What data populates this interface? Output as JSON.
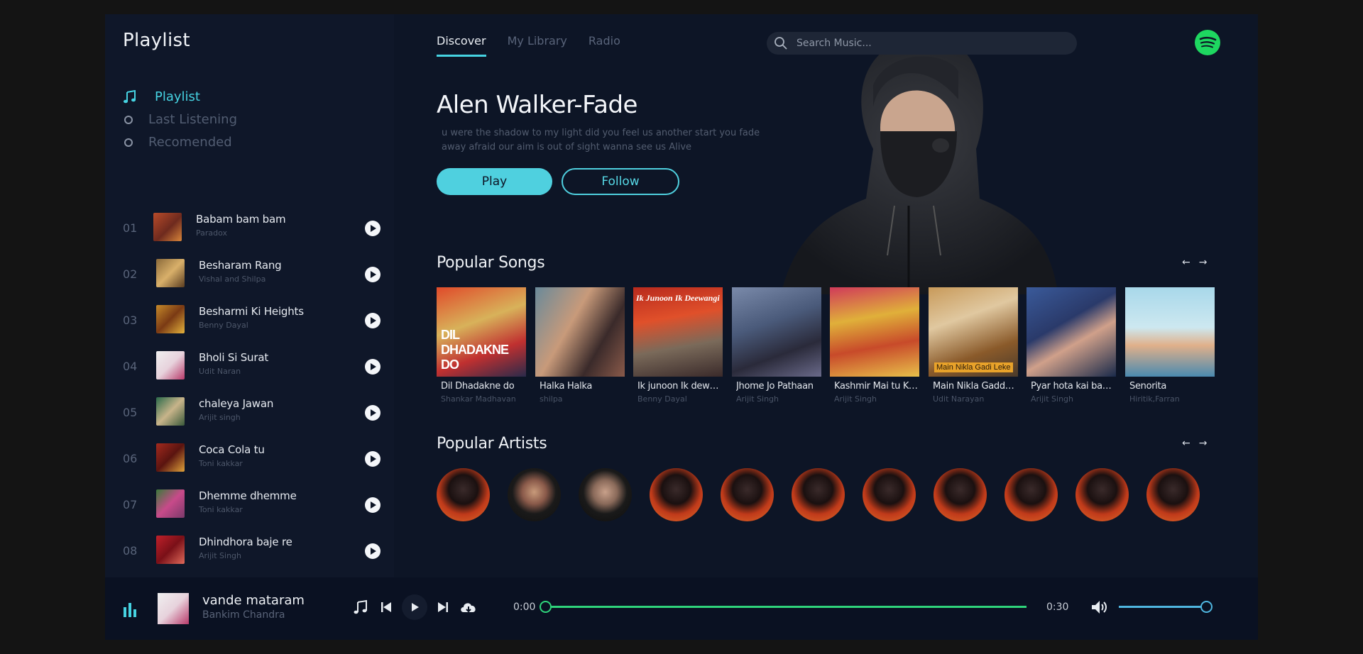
{
  "sidebar": {
    "title": "Playlist",
    "nav": [
      {
        "label": "Playlist",
        "icon": "music-note-icon",
        "active": true
      },
      {
        "label": "Last Listening",
        "icon": "circle-icon",
        "active": false
      },
      {
        "label": "Recomended",
        "icon": "circle-icon",
        "active": false
      }
    ],
    "tracks": [
      {
        "num": "01",
        "title": "Babam bam bam",
        "artist": "Paradox"
      },
      {
        "num": "02",
        "title": "Besharam Rang",
        "artist": "Vishal and Shilpa"
      },
      {
        "num": "03",
        "title": "Besharmi Ki Heights",
        "artist": "Benny Dayal"
      },
      {
        "num": "04",
        "title": "Bholi Si Surat",
        "artist": "Udit Naran"
      },
      {
        "num": "05",
        "title": "chaleya Jawan",
        "artist": "Arijit singh"
      },
      {
        "num": "06",
        "title": "Coca Cola tu",
        "artist": "Toni kakkar"
      },
      {
        "num": "07",
        "title": "Dhemme dhemme",
        "artist": "Toni kakkar"
      },
      {
        "num": "08",
        "title": "Dhindhora baje re",
        "artist": "Arijit Singh"
      }
    ]
  },
  "header": {
    "tabs": [
      {
        "label": "Discover",
        "active": true
      },
      {
        "label": "My Library",
        "active": false
      },
      {
        "label": "Radio",
        "active": false
      }
    ],
    "search_placeholder": "Search Music..."
  },
  "hero": {
    "title": "Alen Walker-Fade",
    "lyrics": "u were the shadow to my light did you feel us another start you fade away afraid our aim is out of sight wanna see us Alive",
    "play_label": "Play",
    "follow_label": "Follow"
  },
  "popular_songs": {
    "title": "Popular Songs",
    "prev": "←",
    "next": "→",
    "items": [
      {
        "title": "Dil Dhadakne do",
        "artist": "Shankar Madhavan",
        "cover_text": "DIL DHADAKNE DO"
      },
      {
        "title": "Halka Halka",
        "artist": "shilpa"
      },
      {
        "title": "Ik junoon Ik dewan...",
        "artist": "Benny Dayal",
        "cover_text": "Ik Junoon Ik Deewangi"
      },
      {
        "title": "Jhome Jo Pathaan",
        "artist": "Arijit Singh"
      },
      {
        "title": "Kashmir Mai tu Ka...",
        "artist": "Arijit Singh"
      },
      {
        "title": "Main Nikla Gaddi L...",
        "artist": "Udit Narayan",
        "cover_text": "Main Nikla Gadi Leke"
      },
      {
        "title": "Pyar hota kai bar ...",
        "artist": "Arijit Singh"
      },
      {
        "title": "Senorita",
        "artist": "Hiritik,Farran"
      }
    ]
  },
  "popular_artists": {
    "title": "Popular Artists",
    "prev": "←",
    "next": "→",
    "count": 11
  },
  "player": {
    "title": "vande mataram",
    "artist": "Bankim Chandra",
    "time_current": "0:00",
    "time_total": "0:30",
    "progress": 0.0,
    "volume": 1.0
  },
  "colors": {
    "accent": "#46d3e2",
    "seek": "#2fd47b",
    "spotify": "#1ed760",
    "background": "#0d1526"
  }
}
